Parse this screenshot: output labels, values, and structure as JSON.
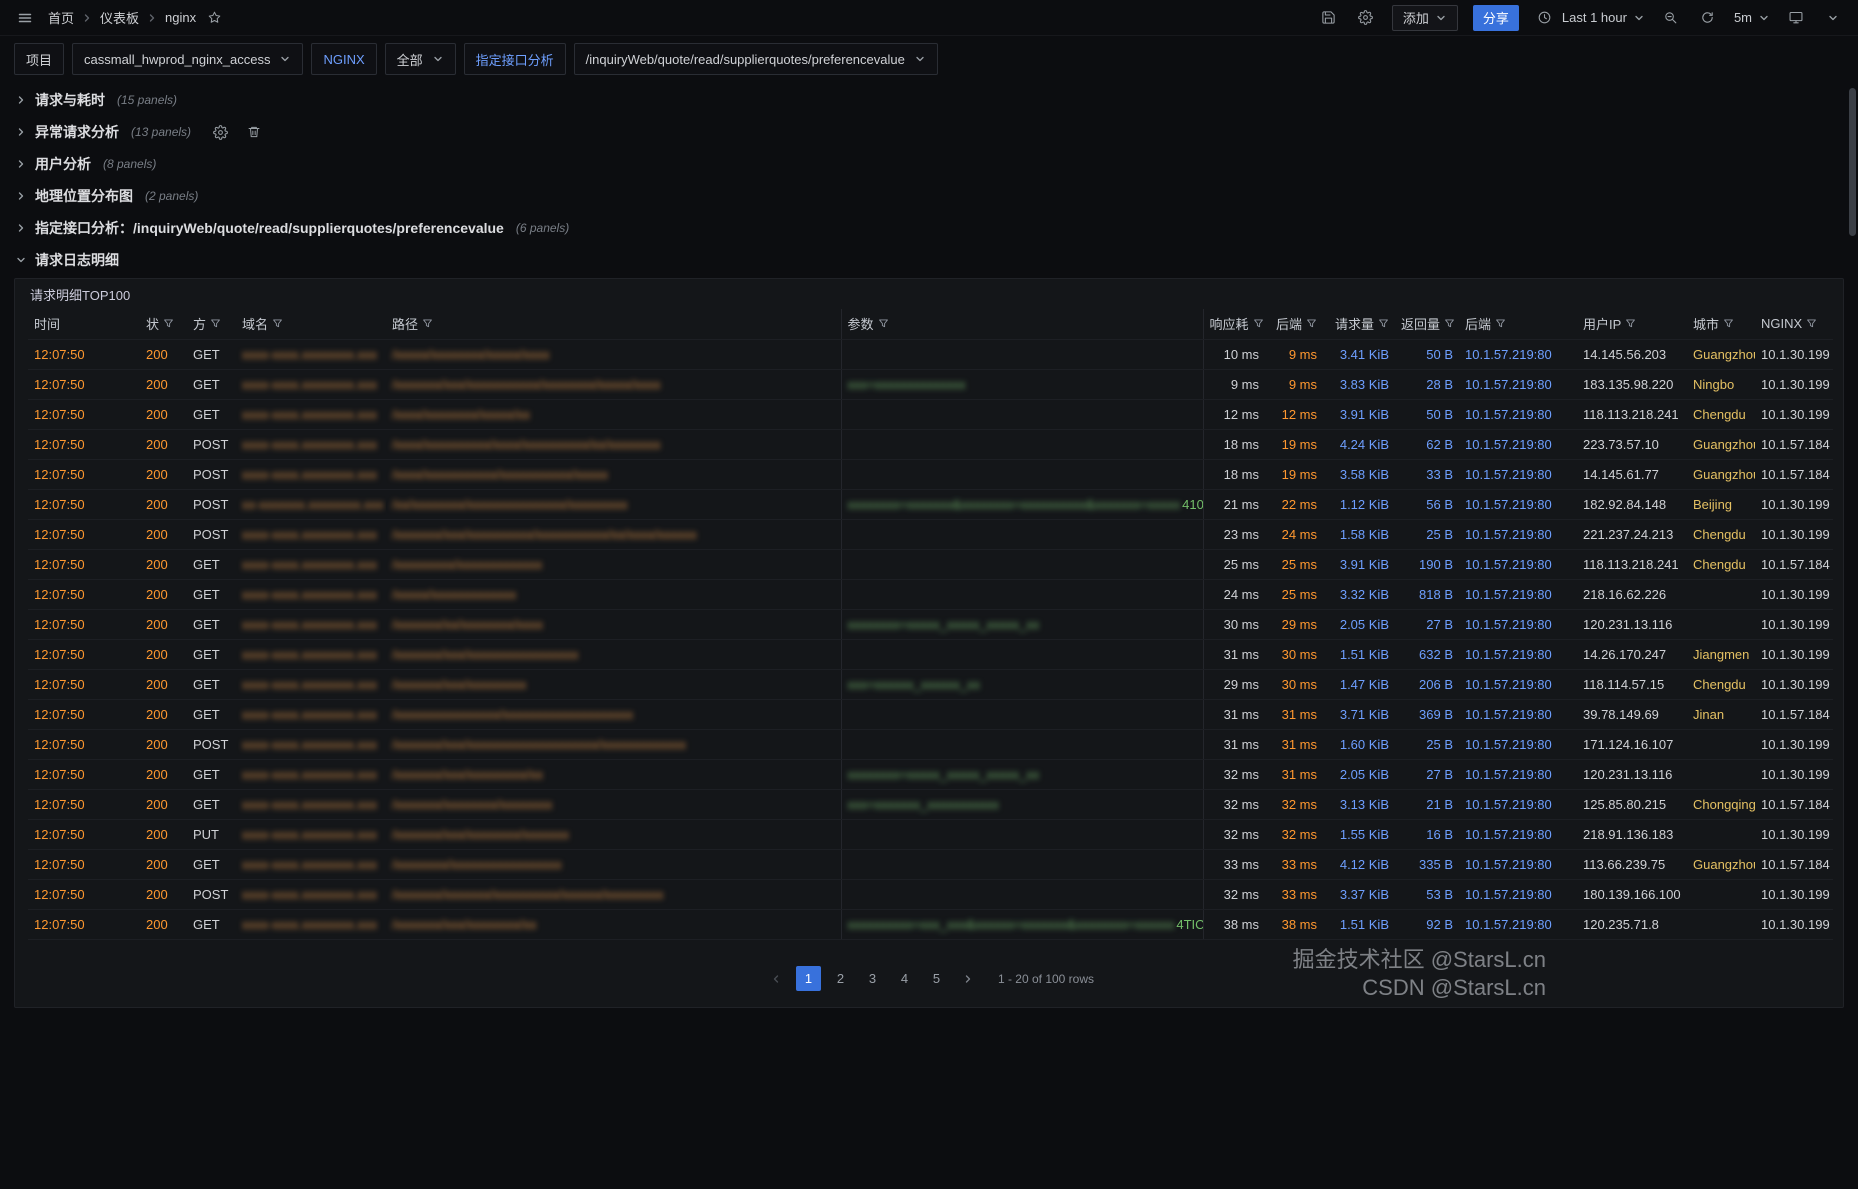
{
  "topnav": {
    "breadcrumb": [
      "首页",
      "仪表板",
      "nginx"
    ],
    "add_label": "添加",
    "share_label": "分享",
    "time_range": "Last 1 hour",
    "refresh_interval": "5m"
  },
  "variables": [
    {
      "text": "项目",
      "type": "label"
    },
    {
      "text": "cassmall_hwprod_nginx_access",
      "type": "select"
    },
    {
      "text": "NGINX",
      "type": "label",
      "accent": true
    },
    {
      "text": "全部",
      "type": "select"
    },
    {
      "text": "指定接口分析",
      "type": "label",
      "accent": true
    },
    {
      "text": "/inquiryWeb/quote/read/supplierquotes/preferencevalue",
      "type": "select"
    }
  ],
  "sections": [
    {
      "title": "请求与耗时",
      "count": "(15 panels)"
    },
    {
      "title": "异常请求分析",
      "count": "(13 panels)",
      "icons": true
    },
    {
      "title": "用户分析",
      "count": "(8 panels)"
    },
    {
      "title": "地理位置分布图",
      "count": "(2 panels)"
    },
    {
      "title": "指定接口分析：/inquiryWeb/quote/read/supplierquotes/preferencevalue",
      "count": "(6 panels)"
    },
    {
      "title": "请求日志明细",
      "count": "",
      "expanded": true
    }
  ],
  "table": {
    "title": "请求明细TOP100",
    "columns": [
      {
        "label": "时间",
        "filter": false,
        "align": "left"
      },
      {
        "label": "状",
        "filter": true,
        "align": "left"
      },
      {
        "label": "方",
        "filter": true,
        "align": "left"
      },
      {
        "label": "域名",
        "filter": true,
        "align": "left"
      },
      {
        "label": "路径",
        "filter": true,
        "align": "left"
      },
      {
        "label": "参数",
        "filter": true,
        "align": "left"
      },
      {
        "label": "响应耗",
        "filter": true,
        "align": "right"
      },
      {
        "label": "后端",
        "filter": true,
        "align": "right"
      },
      {
        "label": "请求量",
        "filter": true,
        "align": "right"
      },
      {
        "label": "返回量",
        "filter": true,
        "align": "right"
      },
      {
        "label": "后端",
        "filter": true,
        "align": "left"
      },
      {
        "label": "用户IP",
        "filter": true,
        "align": "left"
      },
      {
        "label": "城市",
        "filter": true,
        "align": "left"
      },
      {
        "label": "NGINX",
        "filter": true,
        "align": "left"
      }
    ],
    "rows": [
      {
        "time": "12:07:50",
        "status": "200",
        "method": "GET",
        "domain": "xxxx-xxxx.xxxxxxxx.xxx",
        "path": "/xxxxx/xxxxxxxx/xxxxx/xxxx",
        "params": "",
        "params_tail": "",
        "resp": "10 ms",
        "backend": "9 ms",
        "req": "3.41 KiB",
        "ret": "50 B",
        "backend_ip": "10.1.57.219:80",
        "user_ip": "14.145.56.203",
        "city": "Guangzhou",
        "nginx": "10.1.30.199"
      },
      {
        "time": "12:07:50",
        "status": "200",
        "method": "GET",
        "domain": "xxxx-xxxx.xxxxxxxx.xxx",
        "path": "/xxxxxxx/xxx/xxxxxxxxxxx/xxxxxxxx/xxxxx/xxxx",
        "params": "xxx=xxxxxxxxxxxxxx",
        "params_tail": "",
        "resp": "9 ms",
        "backend": "9 ms",
        "req": "3.83 KiB",
        "ret": "28 B",
        "backend_ip": "10.1.57.219:80",
        "user_ip": "183.135.98.220",
        "city": "Ningbo",
        "nginx": "10.1.30.199"
      },
      {
        "time": "12:07:50",
        "status": "200",
        "method": "GET",
        "domain": "xxxx-xxxx.xxxxxxxx.xxx",
        "path": "/xxxx/xxxxxxxx/xxxxx/xx",
        "params": "",
        "params_tail": "",
        "resp": "12 ms",
        "backend": "12 ms",
        "req": "3.91 KiB",
        "ret": "50 B",
        "backend_ip": "10.1.57.219:80",
        "user_ip": "118.113.218.241",
        "city": "Chengdu",
        "nginx": "10.1.30.199"
      },
      {
        "time": "12:07:50",
        "status": "200",
        "method": "POST",
        "domain": "xxxx-xxxx.xxxxxxxx.xxx",
        "path": "/xxxx/xxxxxxxxxx/xxxx/xxxxxxxxxx/xx/xxxxxxxx",
        "params": "",
        "params_tail": "",
        "resp": "18 ms",
        "backend": "19 ms",
        "req": "4.24 KiB",
        "ret": "62 B",
        "backend_ip": "10.1.57.219:80",
        "user_ip": "223.73.57.10",
        "city": "Guangzhou",
        "nginx": "10.1.57.184"
      },
      {
        "time": "12:07:50",
        "status": "200",
        "method": "POST",
        "domain": "xxxx-xxxx.xxxxxxxx.xxx",
        "path": "/xxxx/xxxxxxxxxxx/xxxxxxxxxxx/xxxxx",
        "params": "",
        "params_tail": "",
        "resp": "18 ms",
        "backend": "19 ms",
        "req": "3.58 KiB",
        "ret": "33 B",
        "backend_ip": "10.1.57.219:80",
        "user_ip": "14.145.61.77",
        "city": "Guangzhou",
        "nginx": "10.1.57.184"
      },
      {
        "time": "12:07:50",
        "status": "200",
        "method": "POST",
        "domain": "xx-xxxxxxx.xxxxxxxx.xxx",
        "path": "/xx/xxxxxxxx/xxxxxxxxxxxxxxx/xxxxxxxxx",
        "params": "xxxxxxxx=xxxxxxx&xxxxxxxx=xxxxxxxxxx&xxxxxxx=xxxxx",
        "params_tail": "410",
        "resp": "21 ms",
        "backend": "22 ms",
        "req": "1.12 KiB",
        "ret": "56 B",
        "backend_ip": "10.1.57.219:80",
        "user_ip": "182.92.84.148",
        "city": "Beijing",
        "nginx": "10.1.30.199"
      },
      {
        "time": "12:07:50",
        "status": "200",
        "method": "POST",
        "domain": "xxxx-xxxx.xxxxxxxx.xxx",
        "path": "/xxxxxxx/xxx/xxxxxxxxxx/xxxxxxxxxxx/xx/xxxx/xxxxxx",
        "params": "",
        "params_tail": "",
        "resp": "23 ms",
        "backend": "24 ms",
        "req": "1.58 KiB",
        "ret": "25 B",
        "backend_ip": "10.1.57.219:80",
        "user_ip": "221.237.24.213",
        "city": "Chengdu",
        "nginx": "10.1.30.199"
      },
      {
        "time": "12:07:50",
        "status": "200",
        "method": "GET",
        "domain": "xxxx-xxxx.xxxxxxxx.xxx",
        "path": "/xxxxxxxxx/xxxxxxxxxxxxx",
        "params": "",
        "params_tail": "",
        "resp": "25 ms",
        "backend": "25 ms",
        "req": "3.91 KiB",
        "ret": "190 B",
        "backend_ip": "10.1.57.219:80",
        "user_ip": "118.113.218.241",
        "city": "Chengdu",
        "nginx": "10.1.57.184"
      },
      {
        "time": "12:07:50",
        "status": "200",
        "method": "GET",
        "domain": "xxxx-xxxx.xxxxxxxx.xxx",
        "path": "/xxxxx/xxxxxxxxxxxxx",
        "params": "",
        "params_tail": "",
        "resp": "24 ms",
        "backend": "25 ms",
        "req": "3.32 KiB",
        "ret": "818 B",
        "backend_ip": "10.1.57.219:80",
        "user_ip": "218.16.62.226",
        "city": "",
        "nginx": "10.1.30.199"
      },
      {
        "time": "12:07:50",
        "status": "200",
        "method": "GET",
        "domain": "xxxx-xxxx.xxxxxxxx.xxx",
        "path": "/xxxxxxx/xx/xxxxxxxx/xxxx",
        "params": "xxxxxxxx=xxxxx_xxxxx_xxxxx_xx",
        "params_tail": "",
        "resp": "30 ms",
        "backend": "29 ms",
        "req": "2.05 KiB",
        "ret": "27 B",
        "backend_ip": "10.1.57.219:80",
        "user_ip": "120.231.13.116",
        "city": "",
        "nginx": "10.1.30.199"
      },
      {
        "time": "12:07:50",
        "status": "200",
        "method": "GET",
        "domain": "xxxx-xxxx.xxxxxxxx.xxx",
        "path": "/xxxxxxx/xxx/xxxxxxxxxxxxxxxxx",
        "params": "",
        "params_tail": "",
        "resp": "31 ms",
        "backend": "30 ms",
        "req": "1.51 KiB",
        "ret": "632 B",
        "backend_ip": "10.1.57.219:80",
        "user_ip": "14.26.170.247",
        "city": "Jiangmen",
        "nginx": "10.1.30.199"
      },
      {
        "time": "12:07:50",
        "status": "200",
        "method": "GET",
        "domain": "xxxx-xxxx.xxxxxxxx.xxx",
        "path": "/xxxxxxx/xxx/xxxxxxxxx",
        "params": "xxx=xxxxxx_xxxxxx_xx",
        "params_tail": "",
        "resp": "29 ms",
        "backend": "30 ms",
        "req": "1.47 KiB",
        "ret": "206 B",
        "backend_ip": "10.1.57.219:80",
        "user_ip": "118.114.57.15",
        "city": "Chengdu",
        "nginx": "10.1.30.199"
      },
      {
        "time": "12:07:50",
        "status": "200",
        "method": "GET",
        "domain": "xxxx-xxxx.xxxxxxxx.xxx",
        "path": "/xxxxxxxxxxxxxxxx/xxxxxxxxxxxxxxxxxxxx",
        "params": "",
        "params_tail": "",
        "resp": "31 ms",
        "backend": "31 ms",
        "req": "3.71 KiB",
        "ret": "369 B",
        "backend_ip": "10.1.57.219:80",
        "user_ip": "39.78.149.69",
        "city": "Jinan",
        "nginx": "10.1.57.184"
      },
      {
        "time": "12:07:50",
        "status": "200",
        "method": "POST",
        "domain": "xxxx-xxxx.xxxxxxxx.xxx",
        "path": "/xxxxxxx/xxx/xxxxxxxxxxxxxxxxxxxx/xxxxxxxxxxxxx",
        "params": "",
        "params_tail": "",
        "resp": "31 ms",
        "backend": "31 ms",
        "req": "1.60 KiB",
        "ret": "25 B",
        "backend_ip": "10.1.57.219:80",
        "user_ip": "171.124.16.107",
        "city": "",
        "nginx": "10.1.30.199"
      },
      {
        "time": "12:07:50",
        "status": "200",
        "method": "GET",
        "domain": "xxxx-xxxx.xxxxxxxx.xxx",
        "path": "/xxxxxxx/xxx/xxxxxxxxx/xx",
        "params": "xxxxxxxx=xxxxx_xxxxx_xxxxx_xx",
        "params_tail": "",
        "resp": "32 ms",
        "backend": "31 ms",
        "req": "2.05 KiB",
        "ret": "27 B",
        "backend_ip": "10.1.57.219:80",
        "user_ip": "120.231.13.116",
        "city": "",
        "nginx": "10.1.30.199"
      },
      {
        "time": "12:07:50",
        "status": "200",
        "method": "GET",
        "domain": "xxxx-xxxx.xxxxxxxx.xxx",
        "path": "/xxxxxxx/xxxxxxxx/xxxxxxxx",
        "params": "xxx=xxxxxxx_xxxxxxxxxxx",
        "params_tail": "",
        "resp": "32 ms",
        "backend": "32 ms",
        "req": "3.13 KiB",
        "ret": "21 B",
        "backend_ip": "10.1.57.219:80",
        "user_ip": "125.85.80.215",
        "city": "Chongqing",
        "nginx": "10.1.57.184"
      },
      {
        "time": "12:07:50",
        "status": "200",
        "method": "PUT",
        "domain": "xxxx-xxxx.xxxxxxxx.xxx",
        "path": "/xxxxxxx/xxx/xxxxxxxx/xxxxxxx",
        "params": "",
        "params_tail": "",
        "resp": "32 ms",
        "backend": "32 ms",
        "req": "1.55 KiB",
        "ret": "16 B",
        "backend_ip": "10.1.57.219:80",
        "user_ip": "218.91.136.183",
        "city": "",
        "nginx": "10.1.30.199"
      },
      {
        "time": "12:07:50",
        "status": "200",
        "method": "GET",
        "domain": "xxxx-xxxx.xxxxxxxx.xxx",
        "path": "/xxxxxxxx/xxxxxxxxxxxxxxxxx",
        "params": "",
        "params_tail": "",
        "resp": "33 ms",
        "backend": "33 ms",
        "req": "4.12 KiB",
        "ret": "335 B",
        "backend_ip": "10.1.57.219:80",
        "user_ip": "113.66.239.75",
        "city": "Guangzhou",
        "nginx": "10.1.57.184"
      },
      {
        "time": "12:07:50",
        "status": "200",
        "method": "POST",
        "domain": "xxxx-xxxx.xxxxxxxx.xxx",
        "path": "/xxxxxxx/xxxxxxx/xxxxxxxxxx/xxxxxx/xxxxxxxxx",
        "params": "",
        "params_tail": "",
        "resp": "32 ms",
        "backend": "33 ms",
        "req": "3.37 KiB",
        "ret": "53 B",
        "backend_ip": "10.1.57.219:80",
        "user_ip": "180.139.166.100",
        "city": "",
        "nginx": "10.1.30.199"
      },
      {
        "time": "12:07:50",
        "status": "200",
        "method": "GET",
        "domain": "xxxx-xxxx.xxxxxxxx.xxx",
        "path": "/xxxxxxx/xxx/xxxxxxxx/xx",
        "params": "xxxxxxxxxx=xxx_xxx&xxxxxx=xxxxxxx&xxxxxxxx=xxxxxx",
        "params_tail": "4TIC",
        "resp": "38 ms",
        "backend": "38 ms",
        "req": "1.51 KiB",
        "ret": "92 B",
        "backend_ip": "10.1.57.219:80",
        "user_ip": "120.235.71.8",
        "city": "",
        "nginx": "10.1.30.199"
      }
    ]
  },
  "pagination": {
    "pages": [
      "1",
      "2",
      "3",
      "4",
      "5"
    ],
    "active": "1",
    "info": "1 - 20 of 100 rows"
  },
  "watermark": {
    "line1": "掘金技术社区 @StarsL.cn",
    "line2": "CSDN @StarsL.cn"
  }
}
